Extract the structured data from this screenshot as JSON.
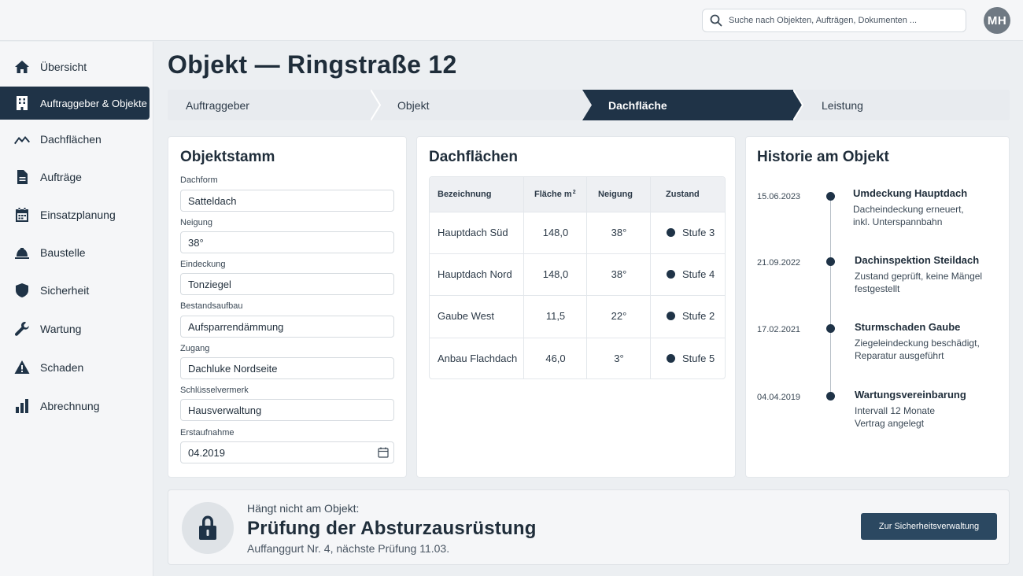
{
  "search": {
    "placeholder": "Suche nach Objekten, Aufträgen, Dokumenten ..."
  },
  "user": {
    "initials": "MH"
  },
  "sidebar": {
    "items": [
      {
        "label": "Übersicht",
        "icon": "home-icon"
      },
      {
        "label": "Auftraggeber & Objekte",
        "icon": "building-icon",
        "active": true
      },
      {
        "label": "Dachflächen",
        "icon": "roof-icon"
      },
      {
        "label": "Aufträge",
        "icon": "document-icon"
      },
      {
        "label": "Einsatzplanung",
        "icon": "calendar-icon"
      },
      {
        "label": "Baustelle",
        "icon": "helmet-icon"
      },
      {
        "label": "Sicherheit",
        "icon": "shield-icon"
      },
      {
        "label": "Wartung",
        "icon": "wrench-icon"
      },
      {
        "label": "Schaden",
        "icon": "warning-icon"
      },
      {
        "label": "Abrechnung",
        "icon": "bar-chart-icon"
      }
    ]
  },
  "page": {
    "title": "Objekt — Ringstraße 12"
  },
  "steps": [
    {
      "label": "Auftraggeber"
    },
    {
      "label": "Objekt"
    },
    {
      "label": "Dachfläche",
      "active": true
    },
    {
      "label": "Leistung"
    }
  ],
  "objektstamm": {
    "title": "Objektstamm",
    "fields": [
      {
        "label": "Dachform",
        "value": "Satteldach"
      },
      {
        "label": "Neigung",
        "value": "38°"
      },
      {
        "label": "Eindeckung",
        "value": "Tonziegel"
      },
      {
        "label": "Bestandsaufbau",
        "value": "Aufsparrendämmung"
      },
      {
        "label": "Zugang",
        "value": "Dachluke Nordseite"
      },
      {
        "label": "Schlüsselvermerk",
        "value": "Hausverwaltung"
      },
      {
        "label": "Erstaufnahme",
        "value": "04.2019"
      }
    ]
  },
  "dachflaechen": {
    "title": "Dachflächen",
    "columns": [
      "Bezeichnung",
      "Fläche m",
      "2",
      "Neigung",
      "Zustand"
    ],
    "rows": [
      {
        "name": "Hauptdach Süd",
        "flaeche": "148,0",
        "neigung": "38°",
        "zustand": "Stufe 3"
      },
      {
        "name": "Hauptdach Nord",
        "flaeche": "148,0",
        "neigung": "38°",
        "zustand": "Stufe 4"
      },
      {
        "name": "Gaube West",
        "flaeche": "11,5",
        "neigung": "22°",
        "zustand": "Stufe 2"
      },
      {
        "name": "Anbau Flachdach",
        "flaeche": "46,0",
        "neigung": "3°",
        "zustand": "Stufe 5"
      }
    ]
  },
  "historie": {
    "title": "Historie am Objekt",
    "entries": [
      {
        "date": "15.06.2023",
        "title": "Umdeckung Hauptdach",
        "line1": "Dacheindeckung erneuert,",
        "line2": "inkl. Unterspannbahn"
      },
      {
        "date": "21.09.2022",
        "title": "Dachinspektion Steildach",
        "line1": "Zustand geprüft, keine Mängel",
        "line2": "festgestellt"
      },
      {
        "date": "17.02.2021",
        "title": "Sturmschaden Gaube",
        "line1": "Ziegeleindeckung beschädigt,",
        "line2": "Reparatur ausgeführt"
      },
      {
        "date": "04.04.2019",
        "title": "Wartungsvereinbarung",
        "line1": "Intervall 12 Monate",
        "line2": "Vertrag angelegt"
      }
    ]
  },
  "banner": {
    "subtitle": "Hängt nicht am Objekt:",
    "title": "Prüfung der Absturzausrüstung",
    "desc": "Auffanggurt Nr. 4, nächste Prüfung 11.03.",
    "button": "Zur Sicherheitsverwaltung",
    "icon": "lock-icon"
  },
  "colors": {
    "primary": "#1f3347",
    "button": "#2b4861",
    "background": "#eceff2"
  }
}
